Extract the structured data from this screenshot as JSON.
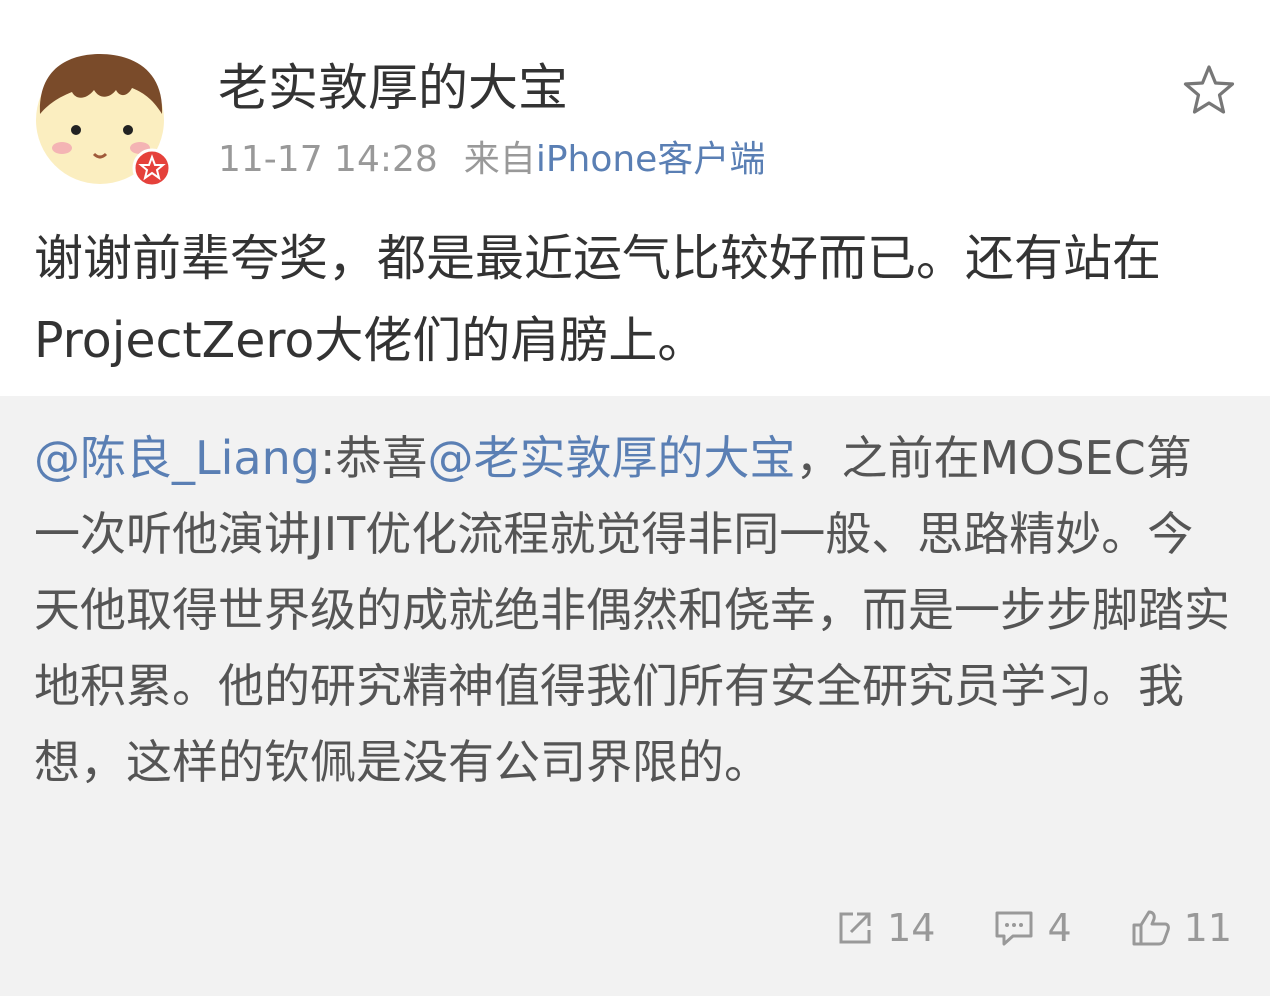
{
  "post": {
    "author": "老实敦厚的大宝",
    "time": "11-17 14:28",
    "source_prefix": "来自",
    "source_link": "iPhone客户端",
    "text": "谢谢前辈夸奖，都是最近运气比较好而已。还有站在ProjectZero大佬们的肩膀上。",
    "icons": {
      "avatar": "cartoon-avatar",
      "badge": "red-badge-icon",
      "favorite": "star-outline-icon"
    }
  },
  "repost": {
    "mention_author": "@陈良_Liang",
    "colon": ":",
    "text_part1": "恭喜",
    "mention_user": "@老实敦厚的大宝",
    "text_part2": "，之前在MOSEC第一次听他演讲JIT优化流程就觉得非同一般、思路精妙。今天他取得世界级的成就绝非偶然和侥幸，而是一步步脚踏实地积累。他的研究精神值得我们所有安全研究员学习。我想，这样的钦佩是没有公司界限的。",
    "actions": {
      "share": {
        "icon": "share-icon",
        "count": "14"
      },
      "comment": {
        "icon": "comment-icon",
        "count": "4"
      },
      "like": {
        "icon": "thumbs-up-icon",
        "count": "11"
      }
    }
  },
  "colors": {
    "link": "#5a7fb4",
    "secondary_text": "#999999",
    "repost_background": "#f2f2f2",
    "badge": "#e5413b"
  }
}
